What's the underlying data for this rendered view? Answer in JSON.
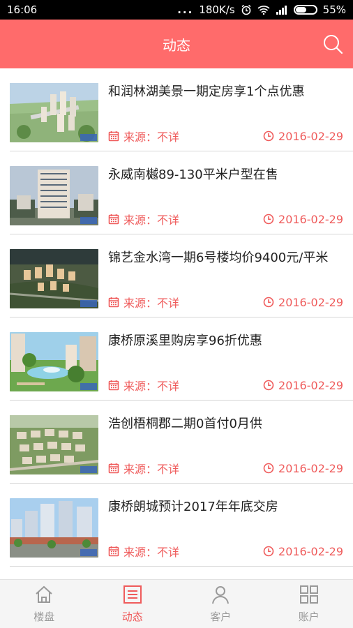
{
  "status_bar": {
    "time": "16:06",
    "signal_dots": "...",
    "net_speed": "180K/s",
    "battery": "55%",
    "battery_level": 0.55
  },
  "header": {
    "title": "动态",
    "search_icon": "search-icon"
  },
  "colors": {
    "header": "#ff6b6b",
    "accent": "#ef5b5b",
    "inactive_tab": "#999999"
  },
  "news": [
    {
      "title": "和润林湖美景一期定房享1个点优惠",
      "source": "来源：不详",
      "date": "2016-02-29",
      "thumb": "aerial-green"
    },
    {
      "title": "永威南樾89-130平米户型在售",
      "source": "来源：不详",
      "date": "2016-02-29",
      "thumb": "tower"
    },
    {
      "title": "锦艺金水湾一期6号楼均价9400元/平米",
      "source": "来源：不详",
      "date": "2016-02-29",
      "thumb": "aerial-night"
    },
    {
      "title": "康桥原溪里购房享96折优惠",
      "source": "来源：不详",
      "date": "2016-02-29",
      "thumb": "garden"
    },
    {
      "title": "浩创梧桐郡二期0首付0月供",
      "source": "来源：不详",
      "date": "2016-02-29",
      "thumb": "aerial-blocks"
    },
    {
      "title": "康桥朗城预计2017年年底交房",
      "source": "来源：不详",
      "date": "2016-02-29",
      "thumb": "street"
    }
  ],
  "tabs": [
    {
      "label": "楼盘",
      "icon": "house-icon",
      "active": false
    },
    {
      "label": "动态",
      "icon": "list-icon",
      "active": true
    },
    {
      "label": "客户",
      "icon": "person-icon",
      "active": false
    },
    {
      "label": "账户",
      "icon": "grid-icon",
      "active": false
    }
  ]
}
